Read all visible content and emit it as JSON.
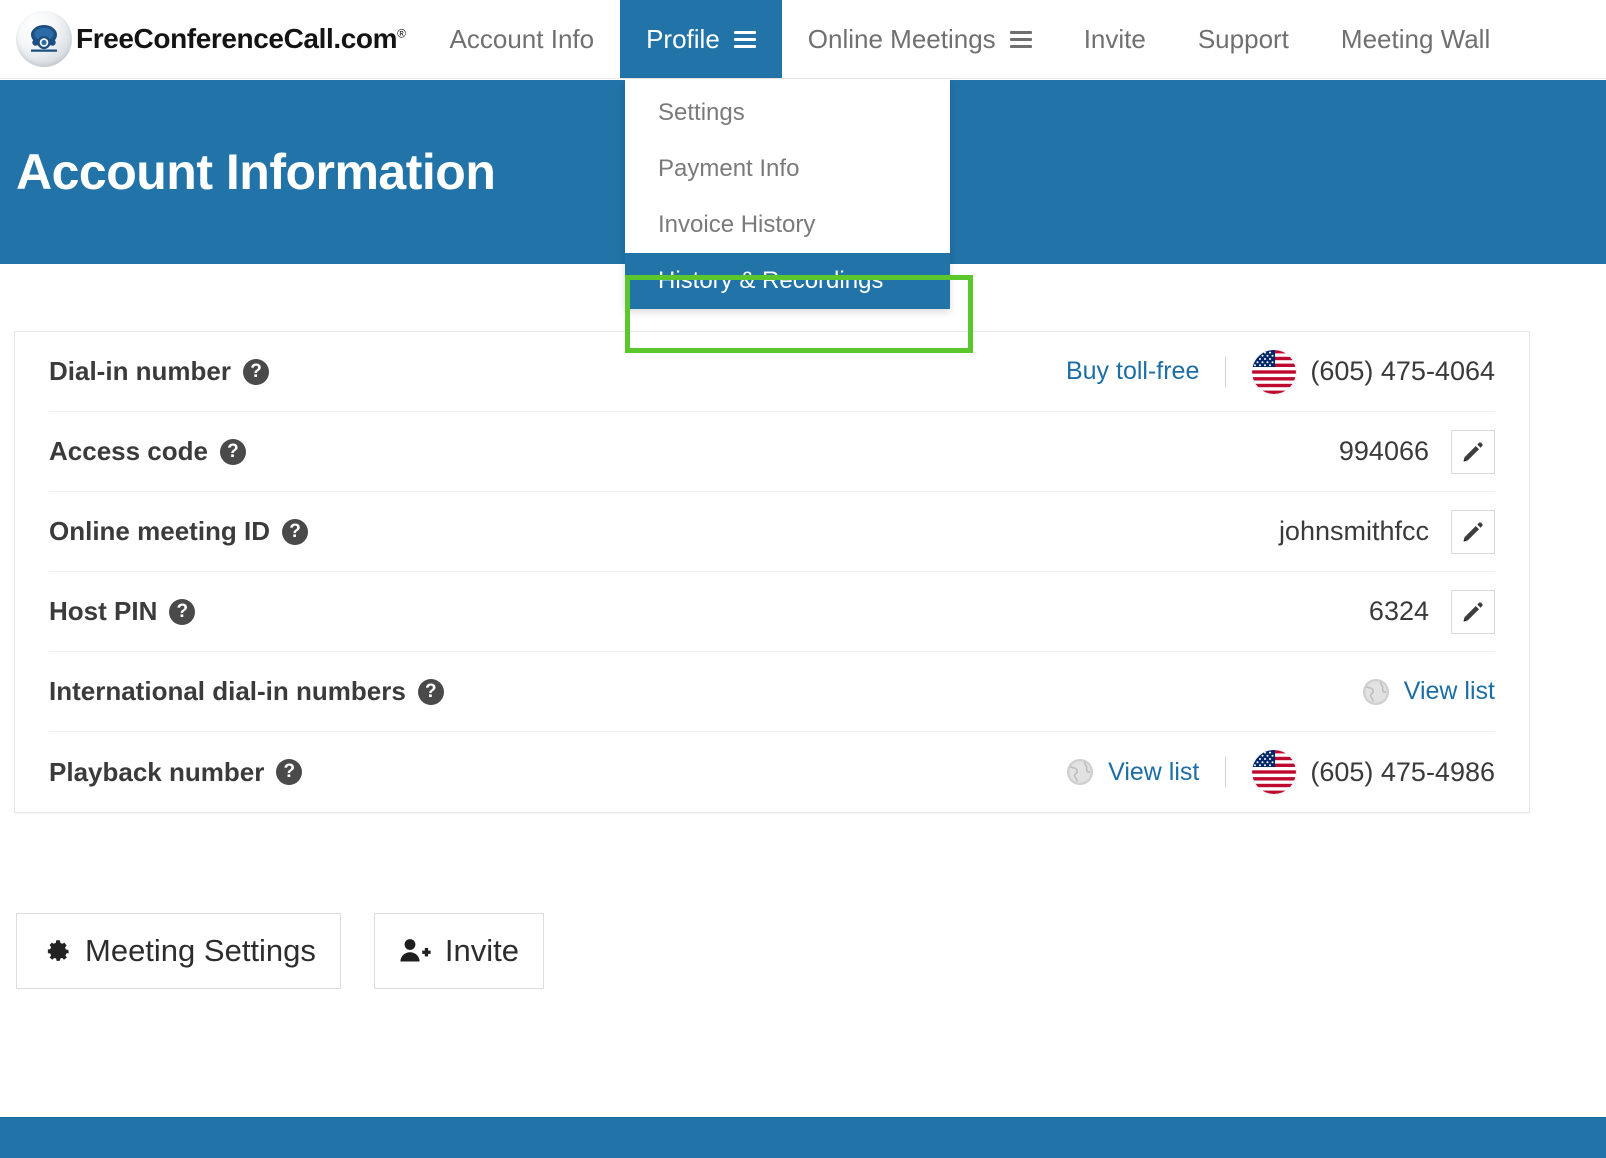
{
  "brand": {
    "name": "FreeConferenceCall.com",
    "registered_mark": "®",
    "logo_icon": "telephone-logo-icon"
  },
  "nav": {
    "items": [
      {
        "label": "Account Info",
        "active": false,
        "has_menu": false
      },
      {
        "label": "Profile",
        "active": true,
        "has_menu": true
      },
      {
        "label": "Online Meetings",
        "active": false,
        "has_menu": true
      },
      {
        "label": "Invite",
        "active": false,
        "has_menu": false
      },
      {
        "label": "Support",
        "active": false,
        "has_menu": false
      },
      {
        "label": "Meeting Wall",
        "active": false,
        "has_menu": false
      }
    ]
  },
  "dropdown": {
    "items": [
      {
        "label": "Settings",
        "selected": false
      },
      {
        "label": "Payment Info",
        "selected": false
      },
      {
        "label": "Invoice History",
        "selected": false
      },
      {
        "label": "History & Recordings",
        "selected": true
      }
    ],
    "highlight_color": "#5cc72c"
  },
  "banner": {
    "title": "Account Information",
    "color": "#2273a8"
  },
  "account": {
    "rows": [
      {
        "label": "Dial-in number",
        "help_icon": "question-mark-icon",
        "link": "Buy toll-free",
        "flag_icon": "us-flag-icon",
        "value": "(605) 475-4064",
        "has_edit": false,
        "has_globe": false,
        "has_separator": true
      },
      {
        "label": "Access code",
        "help_icon": "question-mark-icon",
        "link": "",
        "flag_icon": "",
        "value": "994066",
        "has_edit": true,
        "has_globe": false,
        "has_separator": false
      },
      {
        "label": "Online meeting ID",
        "help_icon": "question-mark-icon",
        "link": "",
        "flag_icon": "",
        "value": "johnsmithfcc",
        "has_edit": true,
        "has_globe": false,
        "has_separator": false
      },
      {
        "label": "Host PIN",
        "help_icon": "question-mark-icon",
        "link": "",
        "flag_icon": "",
        "value": "6324",
        "has_edit": true,
        "has_globe": false,
        "has_separator": false
      },
      {
        "label": "International dial-in numbers",
        "help_icon": "question-mark-icon",
        "link": "View list",
        "flag_icon": "",
        "value": "",
        "has_edit": false,
        "has_globe": true,
        "has_separator": false
      },
      {
        "label": "Playback number",
        "help_icon": "question-mark-icon",
        "link": "View list",
        "flag_icon": "us-flag-icon",
        "value": "(605) 475-4986",
        "has_edit": false,
        "has_globe": true,
        "has_separator": true
      }
    ]
  },
  "actions": [
    {
      "label": "Meeting Settings",
      "icon": "gear-icon"
    },
    {
      "label": "Invite",
      "icon": "add-user-icon"
    }
  ],
  "colors": {
    "accent_blue": "#2273a8",
    "link_blue": "#1c6ea4",
    "highlight_green": "#5cc72c"
  }
}
